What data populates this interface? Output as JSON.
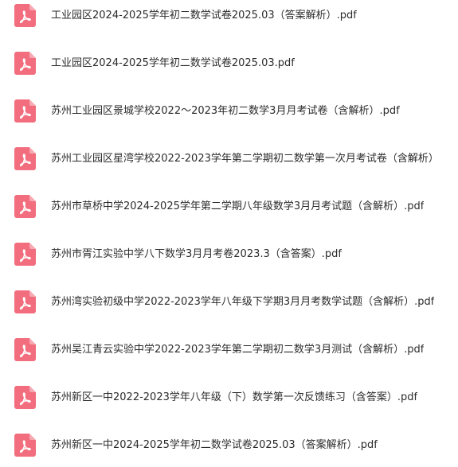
{
  "files": [
    {
      "name": "工业园区2024-2025学年初二数学试卷2025.03（答案解析）.pdf",
      "icon": "pdf-icon"
    },
    {
      "name": "工业园区2024-2025学年初二数学试卷2025.03.pdf",
      "icon": "pdf-icon"
    },
    {
      "name": "苏州工业园区景城学校2022～2023年初二数学3月月考试卷（含解析）.pdf",
      "icon": "pdf-icon"
    },
    {
      "name": "苏州工业园区星湾学校2022-2023学年第二学期初二数学第一次月考试卷（含解析）",
      "icon": "pdf-icon"
    },
    {
      "name": "苏州市草桥中学2024-2025学年第二学期八年级数学3月月考试题（含解析）.pdf",
      "icon": "pdf-icon"
    },
    {
      "name": "苏州市胥江实验中学八下数学3月月考卷2023.3（含答案）.pdf",
      "icon": "pdf-icon"
    },
    {
      "name": "苏州湾实验初级中学2022-2023学年八年级下学期3月月考数学试题（含解析）.pdf",
      "icon": "pdf-icon"
    },
    {
      "name": "苏州吴江青云实验中学2022-2023学年第二学期初二数学3月测试（含解析）.pdf",
      "icon": "pdf-icon"
    },
    {
      "name": "苏州新区一中2022-2023学年八年级（下）数学第一次反馈练习（含答案）.pdf",
      "icon": "pdf-icon"
    },
    {
      "name": "苏州新区一中2024-2025学年初二数学试卷2025.03（答案解析）.pdf",
      "icon": "pdf-icon"
    }
  ],
  "colors": {
    "icon_fill": "#f26d7d",
    "icon_fold": "#f7a9b3",
    "icon_glyph": "#ffffff",
    "text": "#2b2b2b",
    "background": "#ffffff"
  }
}
